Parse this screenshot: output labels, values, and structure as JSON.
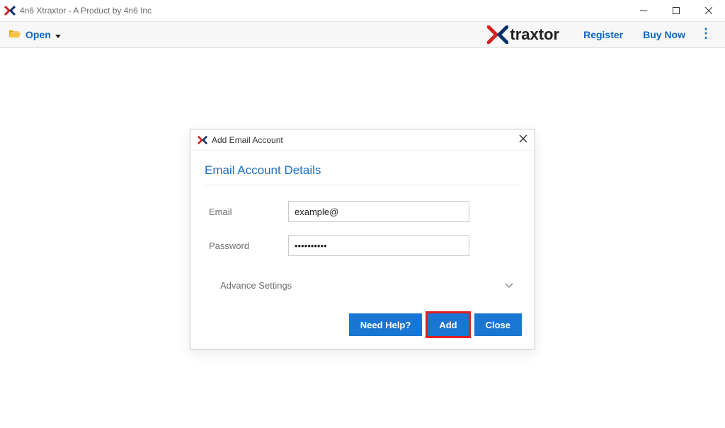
{
  "window": {
    "title": "4n6 Xtraxtor - A Product by 4n6 Inc"
  },
  "toolbar": {
    "open_label": "Open",
    "brand_text": "traxtor",
    "register_label": "Register",
    "buy_now_label": "Buy Now"
  },
  "dialog": {
    "title": "Add Email Account",
    "section_title": "Email Account Details",
    "email_label": "Email",
    "email_value": "example@",
    "password_label": "Password",
    "password_value": "••••••••••",
    "advance_label": "Advance Settings",
    "btn_help": "Need Help?",
    "btn_add": "Add",
    "btn_close": "Close"
  }
}
